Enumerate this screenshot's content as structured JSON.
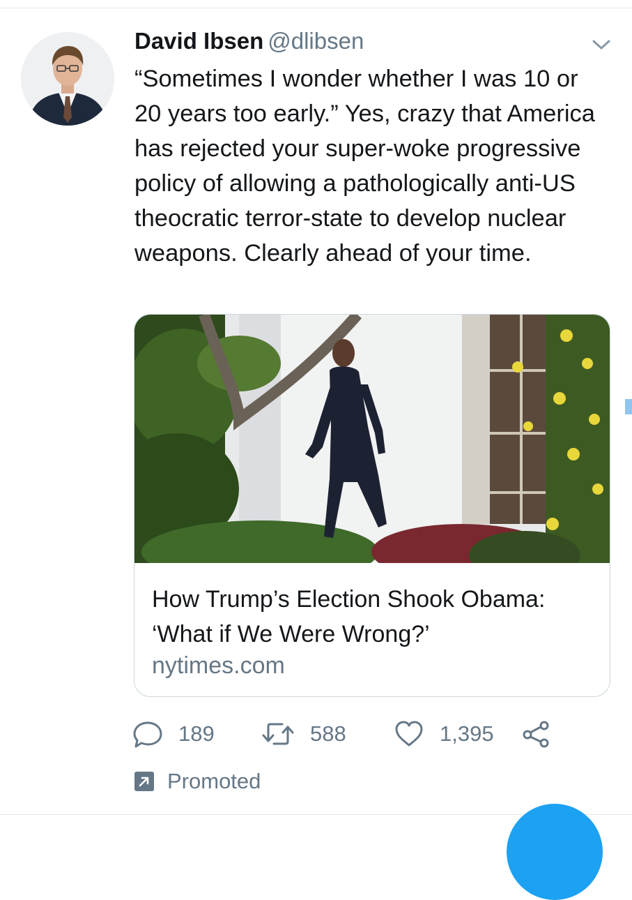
{
  "tweet": {
    "author_name": "David Ibsen",
    "author_handle": "@dlibsen",
    "text": "“Sometimes I wonder whether I was 10 or 20 years too early.” Yes, crazy that America has rejected your super-woke progressive policy of allowing a pathologically anti-US theocratic terror-state to develop nuclear weapons. Clearly ahead of your time.",
    "avatar_icon": "user-avatar",
    "menu_icon": "chevron-down-icon"
  },
  "card": {
    "title_line1": "How Trump’s Election Shook Obama:",
    "title_line2": "‘What if We Were Wrong?’",
    "domain": "nytimes.com"
  },
  "actions": {
    "reply_count": "189",
    "retweet_count": "588",
    "like_count": "1,395"
  },
  "promoted": {
    "label": "Promoted"
  },
  "colors": {
    "text": "#14171a",
    "secondary": "#657786",
    "border": "#ccd6dd",
    "accent": "#1da1f2"
  }
}
